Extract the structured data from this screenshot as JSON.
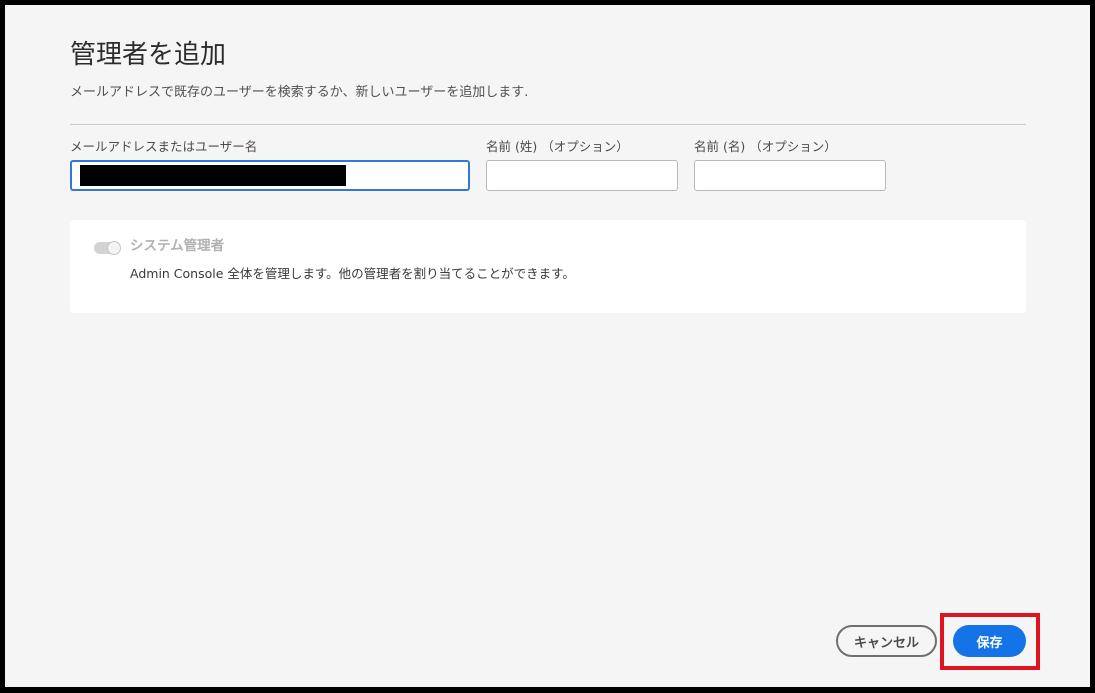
{
  "dialog": {
    "title": "管理者を追加",
    "subtitle": "メールアドレスで既存のユーザーを検索するか、新しいユーザーを追加します."
  },
  "form": {
    "email": {
      "label": "メールアドレスまたはユーザー名",
      "value": "",
      "redacted": true
    },
    "last_name": {
      "label": "名前 (姓) （オプション）",
      "value": ""
    },
    "first_name": {
      "label": "名前 (名) （オプション）",
      "value": ""
    }
  },
  "role": {
    "title": "システム管理者",
    "description": "Admin Console 全体を管理します。他の管理者を割り当てることができます。",
    "toggle_state": "on-disabled"
  },
  "footer": {
    "cancel_label": "キャンセル",
    "save_label": "保存"
  },
  "colors": {
    "accent": "#1473e6",
    "highlight": "#e0141e",
    "background": "#f5f5f5"
  },
  "icons": {
    "toggle": "toggle-switch-icon"
  }
}
